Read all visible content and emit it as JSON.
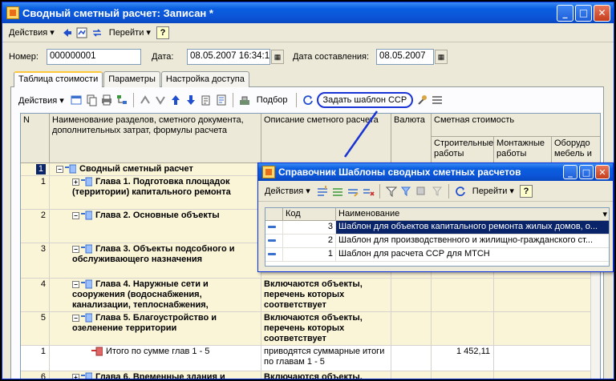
{
  "window": {
    "title": "Сводный сметный расчет: Записан *",
    "minimize": "_",
    "maximize": "□",
    "close": "✕"
  },
  "toolbar": {
    "actions_label": "Действия",
    "goto_label": "Перейти",
    "help_label": "?"
  },
  "fields": {
    "number_label": "Номер:",
    "number_value": "000000001",
    "date_label": "Дата:",
    "date_value": "08.05.2007 16:34:15",
    "compile_date_label": "Дата составления:",
    "compile_date_value": "08.05.2007"
  },
  "tabs": [
    {
      "label": "Таблица стоимости"
    },
    {
      "label": "Параметры"
    },
    {
      "label": "Настройка доступа"
    }
  ],
  "table_toolbar": {
    "actions_label": "Действия",
    "select_label": "Подбор",
    "set_template_label": "Задать шаблон ССР"
  },
  "grid": {
    "headers": {
      "n": "N",
      "name": "Наименование разделов, сметного документа, дополнительных затрат, формулы расчета",
      "description": "Описание сметного расчета",
      "currency": "Валюта",
      "cost": "Сметная стоимость",
      "construction": "Строительные работы",
      "installation": "Монтажные работы",
      "equipment": "Оборудо мебель и"
    },
    "rows": [
      {
        "n": "1",
        "name": "Сводный сметный расчет",
        "description": "",
        "value": ""
      },
      {
        "n": "1",
        "name": "Глава 1. Подготовка площадок (территории) капитального ремонта",
        "description": "",
        "value": ""
      },
      {
        "n": "2",
        "name": "Глава 2. Основные объекты",
        "description": "",
        "value": ""
      },
      {
        "n": "3",
        "name": "Глава 3. Объекты подсобного и обслуживающего назначения",
        "description": "",
        "value": ""
      },
      {
        "n": "4",
        "name": "Глава 4. Наружные сети и сооружения (водоснабжения, канализации, теплоснабжения,",
        "description": "Включаются объекты, перечень которых соответствует",
        "value": ""
      },
      {
        "n": "5",
        "name": "Глава 5. Благоустройство и озеленение территории",
        "description": "Включаются объекты, перечень которых соответствует",
        "value": ""
      },
      {
        "n": "1",
        "name": "Итого по сумме глав 1 - 5",
        "description": "приводятся суммарные итоги по главам 1 - 5",
        "value": "1 452,11"
      },
      {
        "n": "6",
        "name": "Глава 6. Временные здания и",
        "description": "Включаются объекты,",
        "value": ""
      }
    ]
  },
  "popup": {
    "title": "Справочник Шаблоны сводных сметных расчетов",
    "actions_label": "Действия",
    "goto_label": "Перейти",
    "help_label": "?",
    "headers": {
      "code": "Код",
      "name": "Наименование"
    },
    "rows": [
      {
        "code": "3",
        "name": "Шаблон для объектов капитального ремонта жилых домов, о..."
      },
      {
        "code": "2",
        "name": "Шаблон для производственного и жилищно-гражданского ст..."
      },
      {
        "code": "1",
        "name": "Шаблон для расчета ССР для МТСН"
      }
    ]
  },
  "colors": {
    "titlebar": "#0a5ee0",
    "selection": "#0a246a",
    "callout": "#1a33d4",
    "group_row": "#fbf5d8"
  }
}
